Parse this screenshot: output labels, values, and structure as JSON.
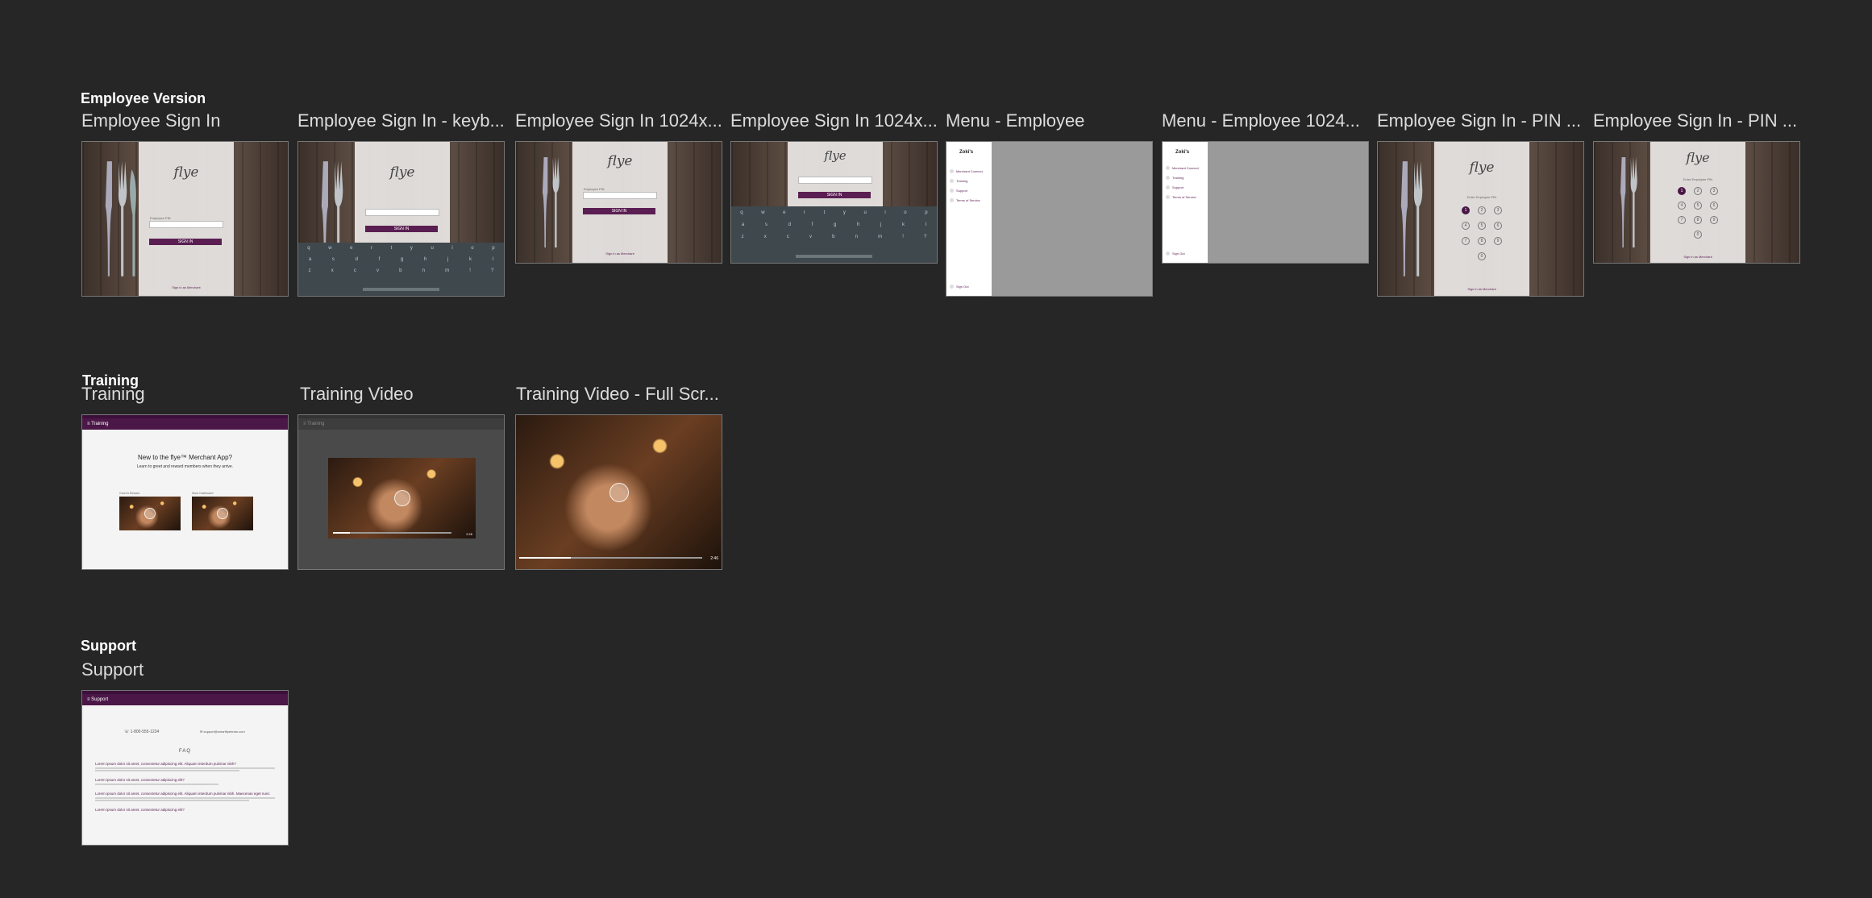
{
  "sections": {
    "employee_version": "Employee Version",
    "training": "Training",
    "support": "Support"
  },
  "artboards": {
    "a1": "Employee Sign In",
    "a2": "Employee Sign In - keyb...",
    "a3": "Employee Sign In 1024x...",
    "a4": "Employee Sign In 1024x...",
    "a5": "Menu - Employee",
    "a6": "Menu - Employee 1024...",
    "a7": "Employee Sign In - PIN  ...",
    "a8": "Employee Sign In - PIN  ...",
    "t1": "Training",
    "t2": "Training Video",
    "t3": "Training Video - Full Scr...",
    "s1": "Support"
  },
  "screens": {
    "logo": "flye",
    "sign_in": "SIGN IN",
    "employee_pin_label": "Employee PIN",
    "enter_pin": "Enter Employee PIN",
    "sign_in_merchant": "Sign in as Merchant",
    "keyboard_row1": [
      "q",
      "w",
      "e",
      "r",
      "t",
      "y",
      "u",
      "i",
      "o",
      "p"
    ],
    "keyboard_row2": [
      "a",
      "s",
      "d",
      "f",
      "g",
      "h",
      "j",
      "k",
      "l"
    ],
    "keyboard_row3": [
      "z",
      "x",
      "c",
      "v",
      "b",
      "n",
      "m",
      "!",
      "?"
    ],
    "pin_keys": [
      "1",
      "2",
      "3",
      "4",
      "5",
      "6",
      "7",
      "8",
      "9",
      "0"
    ],
    "menu": {
      "restaurant": "Zoki's",
      "items": [
        "Merchant Connect",
        "Training",
        "Support",
        "Terms of Service"
      ],
      "sign_out": "Sign Out"
    },
    "training": {
      "appbar": "Training",
      "headline": "New to the flye™ Merchant App?",
      "subline": "Learn to greet and reward members when they arrive.",
      "video1_label": "Greet & Reward",
      "video2_label": "Store Dashboard",
      "video_time": "2:26",
      "full_time": "2:46"
    },
    "support": {
      "appbar": "Support",
      "phone": "1-800-555-1234",
      "email": "support@smartflyebrain.com",
      "faq_title": "FAQ",
      "faq": [
        "Lorem ipsum dolor sit amet, consectetur adipiscing elit. Aliquam interdum pulvinar nibh?",
        "Lorem ipsum dolor sit amet, consectetur adipiscing elit?",
        "Lorem ipsum dolor sit amet, consectetur adipiscing elit. Aliquam interdum pulvinar nibh. Maecenas eget nunc",
        "Lorem ipsum dolor sit amet, consectetur adipiscing elit?"
      ]
    }
  },
  "colors": {
    "background": "#262626",
    "brand_purple": "#4a1747",
    "label": "#dcdcdc"
  }
}
